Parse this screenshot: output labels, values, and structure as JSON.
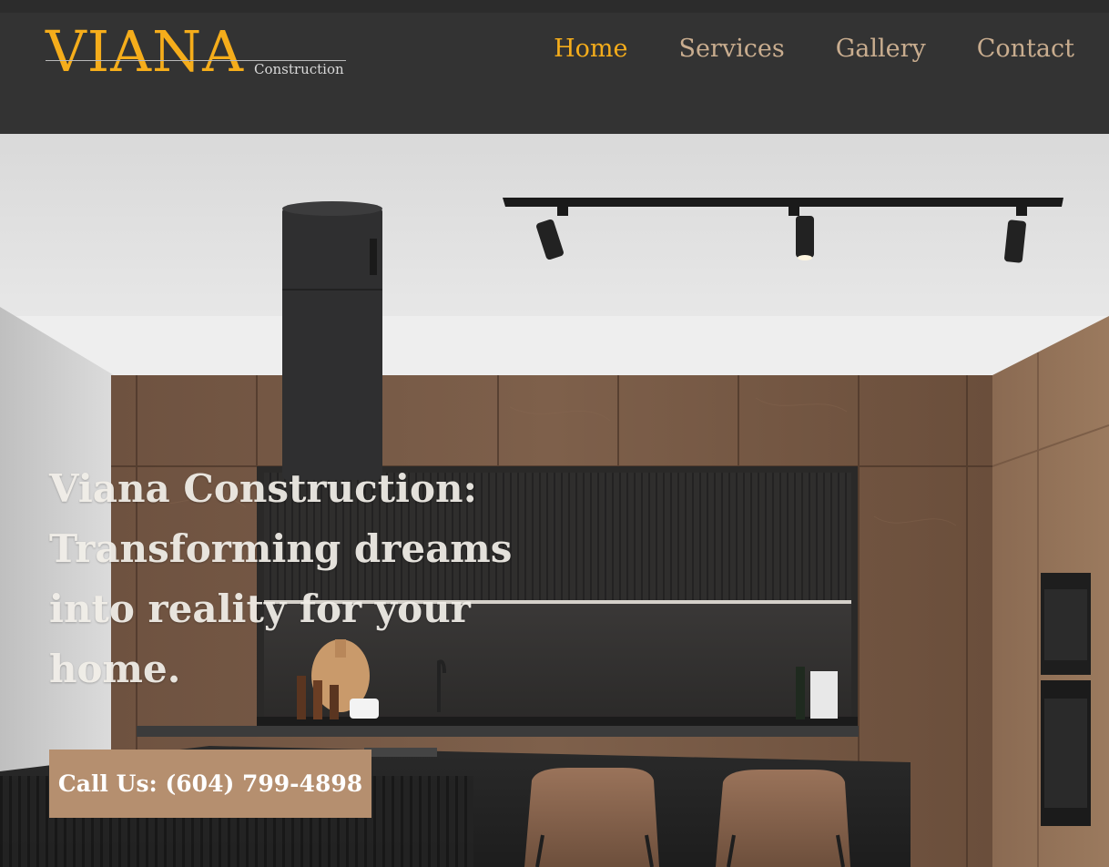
{
  "brand": {
    "name": "VIANA",
    "tagline": "Construction"
  },
  "nav": {
    "items": [
      {
        "label": "Home",
        "active": true
      },
      {
        "label": "Services",
        "active": false
      },
      {
        "label": "Gallery",
        "active": false
      },
      {
        "label": "Contact",
        "active": false
      }
    ]
  },
  "hero": {
    "title": "Viana Construction: Transforming dreams into reality for your home.",
    "cta_label": "Call Us: (604) 799-4898",
    "image": "kitchen-interior-photo"
  },
  "colors": {
    "header_bg": "#333333",
    "brand_gold": "#f5ad1b",
    "nav_text": "#c9ad8f",
    "cta_bg": "#b58f6f"
  }
}
